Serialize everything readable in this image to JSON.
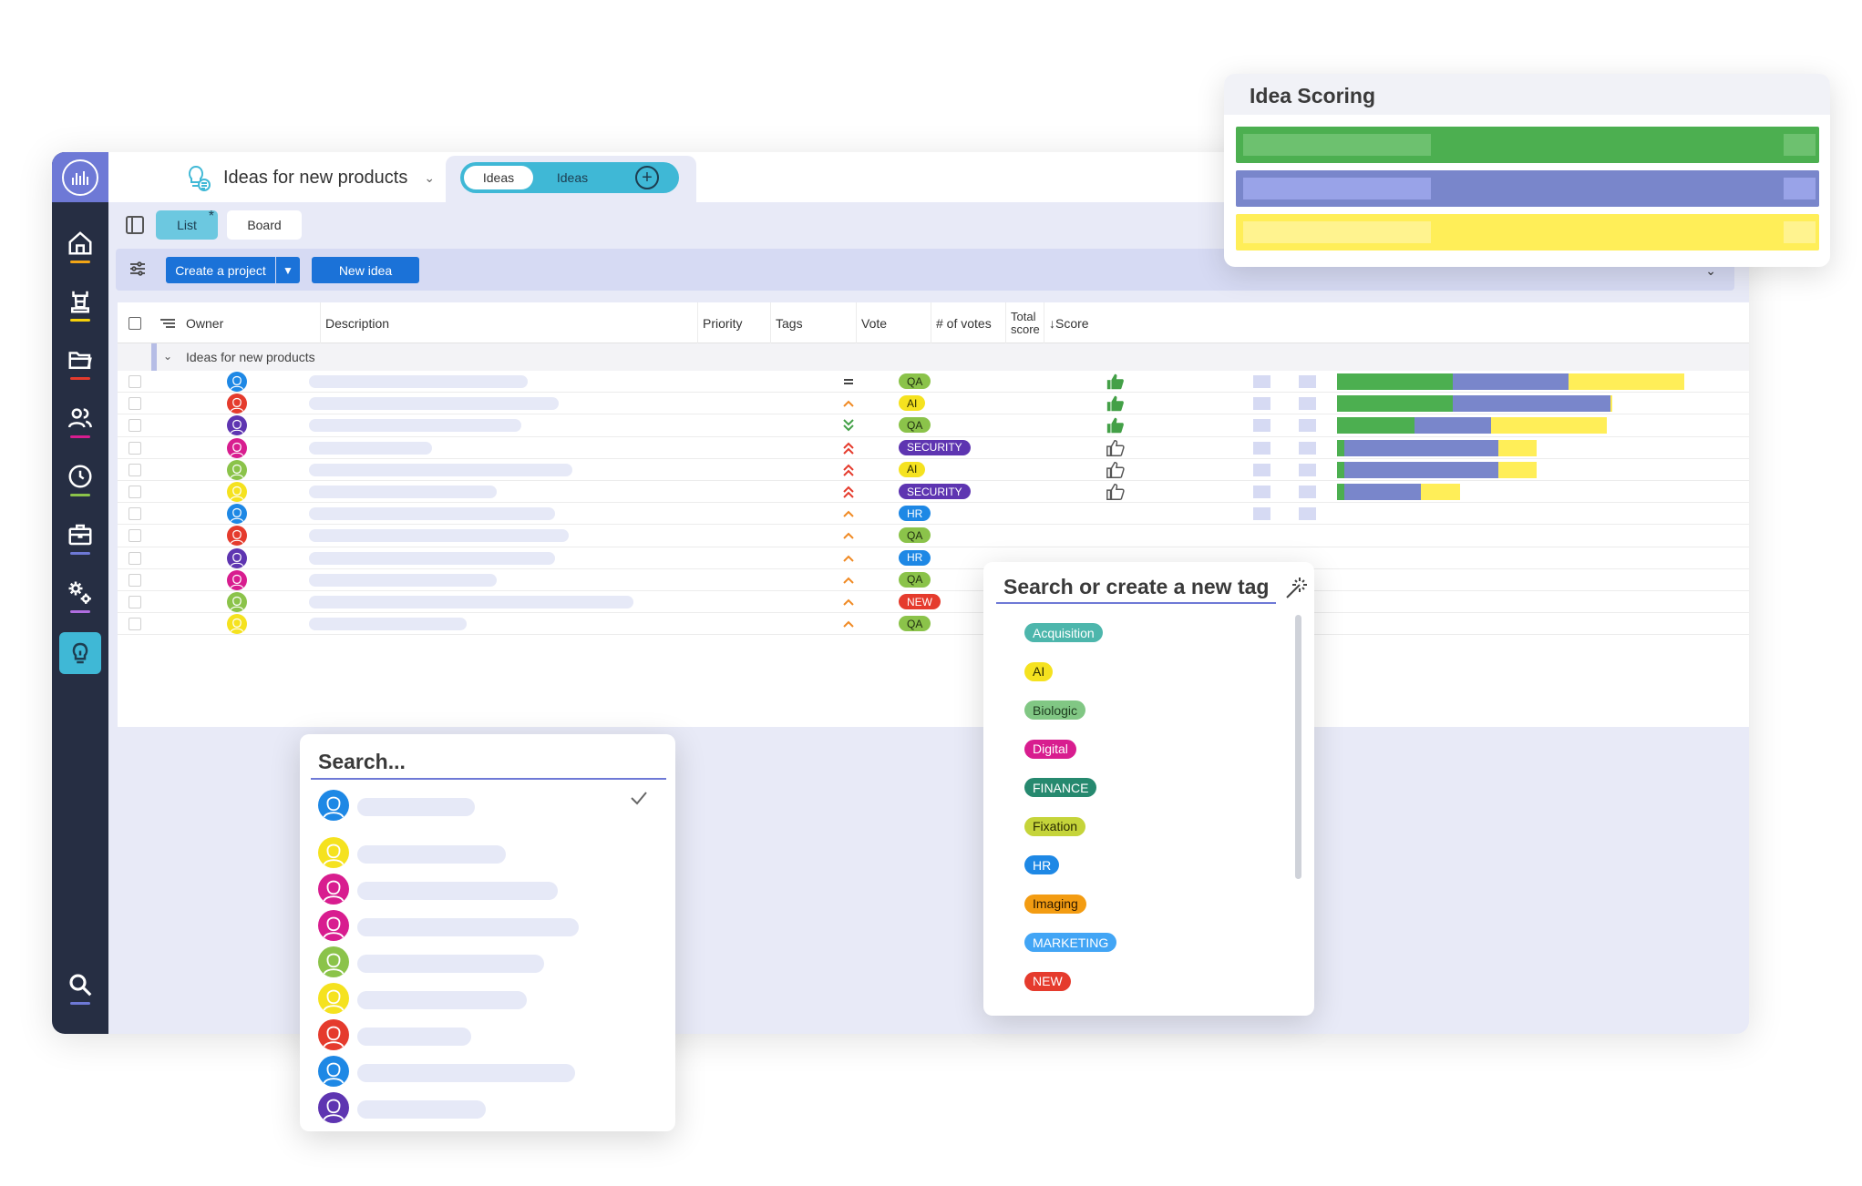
{
  "app": {
    "project_title": "Ideas for new products",
    "tabs": [
      {
        "label": "Ideas"
      },
      {
        "label": "Ideas"
      }
    ],
    "views": {
      "list": "List",
      "list_marker": "*",
      "board": "Board"
    },
    "toolbar": {
      "create_project": "Create a project",
      "new_idea": "New idea"
    }
  },
  "sidebar": {
    "items": [
      {
        "icon": "home-icon",
        "underline": "#f2a516"
      },
      {
        "icon": "chess-rook-icon",
        "underline": "#f5d00a"
      },
      {
        "icon": "folder-icon",
        "underline": "#e53b2d"
      },
      {
        "icon": "users-icon",
        "underline": "#d81d8f"
      },
      {
        "icon": "clock-icon",
        "underline": "#8bc34a"
      },
      {
        "icon": "briefcase-icon",
        "underline": "#6e79d6"
      },
      {
        "icon": "gears-icon",
        "underline": "#b06de0"
      },
      {
        "icon": "lightbulb-icon",
        "underline": ""
      },
      {
        "icon": "search-icon",
        "underline": "#6e79d6"
      }
    ]
  },
  "table": {
    "headers": {
      "owner": "Owner",
      "description": "Description",
      "priority": "Priority",
      "tags": "Tags",
      "vote": "Vote",
      "votes_count": "# of votes",
      "total_score_1": "Total",
      "total_score_2": "score",
      "score": "Score",
      "sort_arrow": "↓"
    },
    "group_label": "Ideas for new products",
    "rows": [
      {
        "owner_color": "#1e88e5",
        "desc_width": 0.64,
        "priority": "=",
        "priority_color": "#444",
        "tag": "QA",
        "tag_bg": "#8bc34a",
        "tag_fg": "#1f2d10",
        "vote": "up-filled",
        "score": [
          0.33,
          0.33,
          0.33
        ]
      },
      {
        "owner_color": "#e53b2d",
        "desc_width": 0.73,
        "priority": "^",
        "priority_color": "#f08a24",
        "tag": "AI",
        "tag_bg": "#f5e21f",
        "tag_fg": "#2b2b00",
        "vote": "up-filled",
        "score": [
          0.33,
          0.45,
          0.005
        ]
      },
      {
        "owner_color": "#5e35b1",
        "desc_width": 0.62,
        "priority": "vv",
        "priority_color": "#43a047",
        "tag": "QA",
        "tag_bg": "#8bc34a",
        "tag_fg": "#1f2d10",
        "vote": "up-filled",
        "score": [
          0.22,
          0.22,
          0.33
        ]
      },
      {
        "owner_color": "#d81d8f",
        "desc_width": 0.36,
        "priority": "^^",
        "priority_color": "#e53b2d",
        "tag": "SECURITY",
        "tag_bg": "#5e35b1",
        "tag_fg": "#ffffff",
        "vote": "up-outline",
        "score": [
          0.02,
          0.44,
          0.11
        ]
      },
      {
        "owner_color": "#8bc34a",
        "desc_width": 0.77,
        "priority": "^^",
        "priority_color": "#e53b2d",
        "tag": "AI",
        "tag_bg": "#f5e21f",
        "tag_fg": "#2b2b00",
        "vote": "up-outline",
        "score": [
          0.02,
          0.44,
          0.11
        ]
      },
      {
        "owner_color": "#f5e21f",
        "desc_width": 0.55,
        "priority": "^^",
        "priority_color": "#e53b2d",
        "tag": "SECURITY",
        "tag_bg": "#5e35b1",
        "tag_fg": "#ffffff",
        "vote": "up-outline",
        "score": [
          0.02,
          0.22,
          0.11
        ]
      },
      {
        "owner_color": "#1e88e5",
        "desc_width": 0.72,
        "priority": "^",
        "priority_color": "#f08a24",
        "tag": "HR",
        "tag_bg": "#1e88e5",
        "tag_fg": "#ffffff",
        "vote": "",
        "score": []
      },
      {
        "owner_color": "#e53b2d",
        "desc_width": 0.76,
        "priority": "^",
        "priority_color": "#f08a24",
        "tag": "QA",
        "tag_bg": "#8bc34a",
        "tag_fg": "#1f2d10",
        "vote": "",
        "score": []
      },
      {
        "owner_color": "#5e35b1",
        "desc_width": 0.72,
        "priority": "^",
        "priority_color": "#f08a24",
        "tag": "HR",
        "tag_bg": "#1e88e5",
        "tag_fg": "#ffffff",
        "vote": "",
        "score": []
      },
      {
        "owner_color": "#d81d8f",
        "desc_width": 0.55,
        "priority": "^",
        "priority_color": "#f08a24",
        "tag": "QA",
        "tag_bg": "#8bc34a",
        "tag_fg": "#1f2d10",
        "vote": "",
        "score": []
      },
      {
        "owner_color": "#8bc34a",
        "desc_width": 0.95,
        "priority": "^",
        "priority_color": "#f08a24",
        "tag": "NEW",
        "tag_bg": "#e53b2d",
        "tag_fg": "#ffffff",
        "vote": "",
        "score": []
      },
      {
        "owner_color": "#f5e21f",
        "desc_width": 0.46,
        "priority": "^",
        "priority_color": "#f08a24",
        "tag": "QA",
        "tag_bg": "#8bc34a",
        "tag_fg": "#1f2d10",
        "vote": "",
        "score": []
      }
    ],
    "score_colors": [
      "#4caf50",
      "#7986cb",
      "#ffee58"
    ]
  },
  "scoring_panel": {
    "title": "Idea Scoring",
    "rows": [
      {
        "color": "#4caf50",
        "inner": "#6dc16f",
        "end": "#6dc16f"
      },
      {
        "color": "#7986cb",
        "inner": "#99a3e8",
        "end": "#99a3e8"
      },
      {
        "color": "#ffee58",
        "inner": "#fff38f",
        "end": "#fff38f"
      }
    ]
  },
  "owner_dropdown": {
    "search_placeholder": "Search...",
    "items": [
      {
        "color": "#1e88e5",
        "bar": 0.34,
        "selected": true
      },
      {
        "color": "#f5e21f",
        "bar": 0.43,
        "selected": false
      },
      {
        "color": "#d81d8f",
        "bar": 0.58,
        "selected": false
      },
      {
        "color": "#d81d8f",
        "bar": 0.64,
        "selected": false
      },
      {
        "color": "#8bc34a",
        "bar": 0.54,
        "selected": false
      },
      {
        "color": "#f5e21f",
        "bar": 0.49,
        "selected": false
      },
      {
        "color": "#e53b2d",
        "bar": 0.33,
        "selected": false
      },
      {
        "color": "#1e88e5",
        "bar": 0.63,
        "selected": false
      },
      {
        "color": "#5e35b1",
        "bar": 0.37,
        "selected": false
      }
    ]
  },
  "tag_dropdown": {
    "search_placeholder": "Search or create a new tag",
    "tags": [
      {
        "label": "Acquisition",
        "bg": "#4db6ac",
        "fg": "#ffffff"
      },
      {
        "label": "AI",
        "bg": "#f5e21f",
        "fg": "#2b2b00"
      },
      {
        "label": "Biologic",
        "bg": "#81c784",
        "fg": "#1f3d20"
      },
      {
        "label": "Digital",
        "bg": "#d81d8f",
        "fg": "#ffffff"
      },
      {
        "label": "FINANCE",
        "bg": "#26896f",
        "fg": "#ffffff"
      },
      {
        "label": "Fixation",
        "bg": "#c5d43a",
        "fg": "#2b2b00"
      },
      {
        "label": "HR",
        "bg": "#1e88e5",
        "fg": "#ffffff"
      },
      {
        "label": "Imaging",
        "bg": "#f39c12",
        "fg": "#2b1800"
      },
      {
        "label": "MARKETING",
        "bg": "#42a5f5",
        "fg": "#ffffff"
      },
      {
        "label": "NEW",
        "bg": "#e53b2d",
        "fg": "#ffffff"
      }
    ]
  }
}
